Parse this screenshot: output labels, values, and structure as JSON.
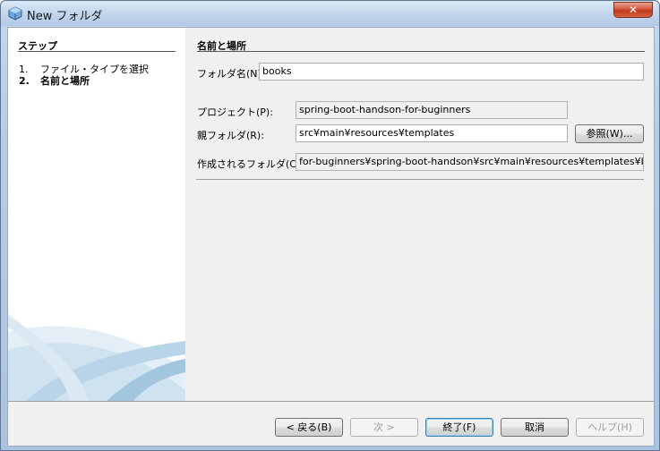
{
  "window": {
    "title": "New フォルダ",
    "close_label": "✕"
  },
  "steps": {
    "title": "ステップ",
    "items": [
      {
        "num": "1.",
        "label": "ファイル・タイプを選択"
      },
      {
        "num": "2.",
        "label": "名前と場所"
      }
    ]
  },
  "form": {
    "section_title": "名前と場所",
    "folder_name_label": "フォルダ名(N):",
    "folder_name_value": "books",
    "project_label": "プロジェクト(P):",
    "project_value": "spring-boot-handson-for-buginners",
    "parent_folder_label": "親フォルダ(R):",
    "parent_folder_value": "src¥main¥resources¥templates",
    "browse_label": "参照(W)...",
    "created_folder_label": "作成されるフォルダ(C):",
    "created_folder_value": "for-buginners¥spring-boot-handson¥src¥main¥resources¥templates¥books"
  },
  "buttons": {
    "back": "< 戻る(B)",
    "next": "次 >",
    "finish": "終了(F)",
    "cancel": "取消",
    "help": "ヘルプ(H)"
  }
}
